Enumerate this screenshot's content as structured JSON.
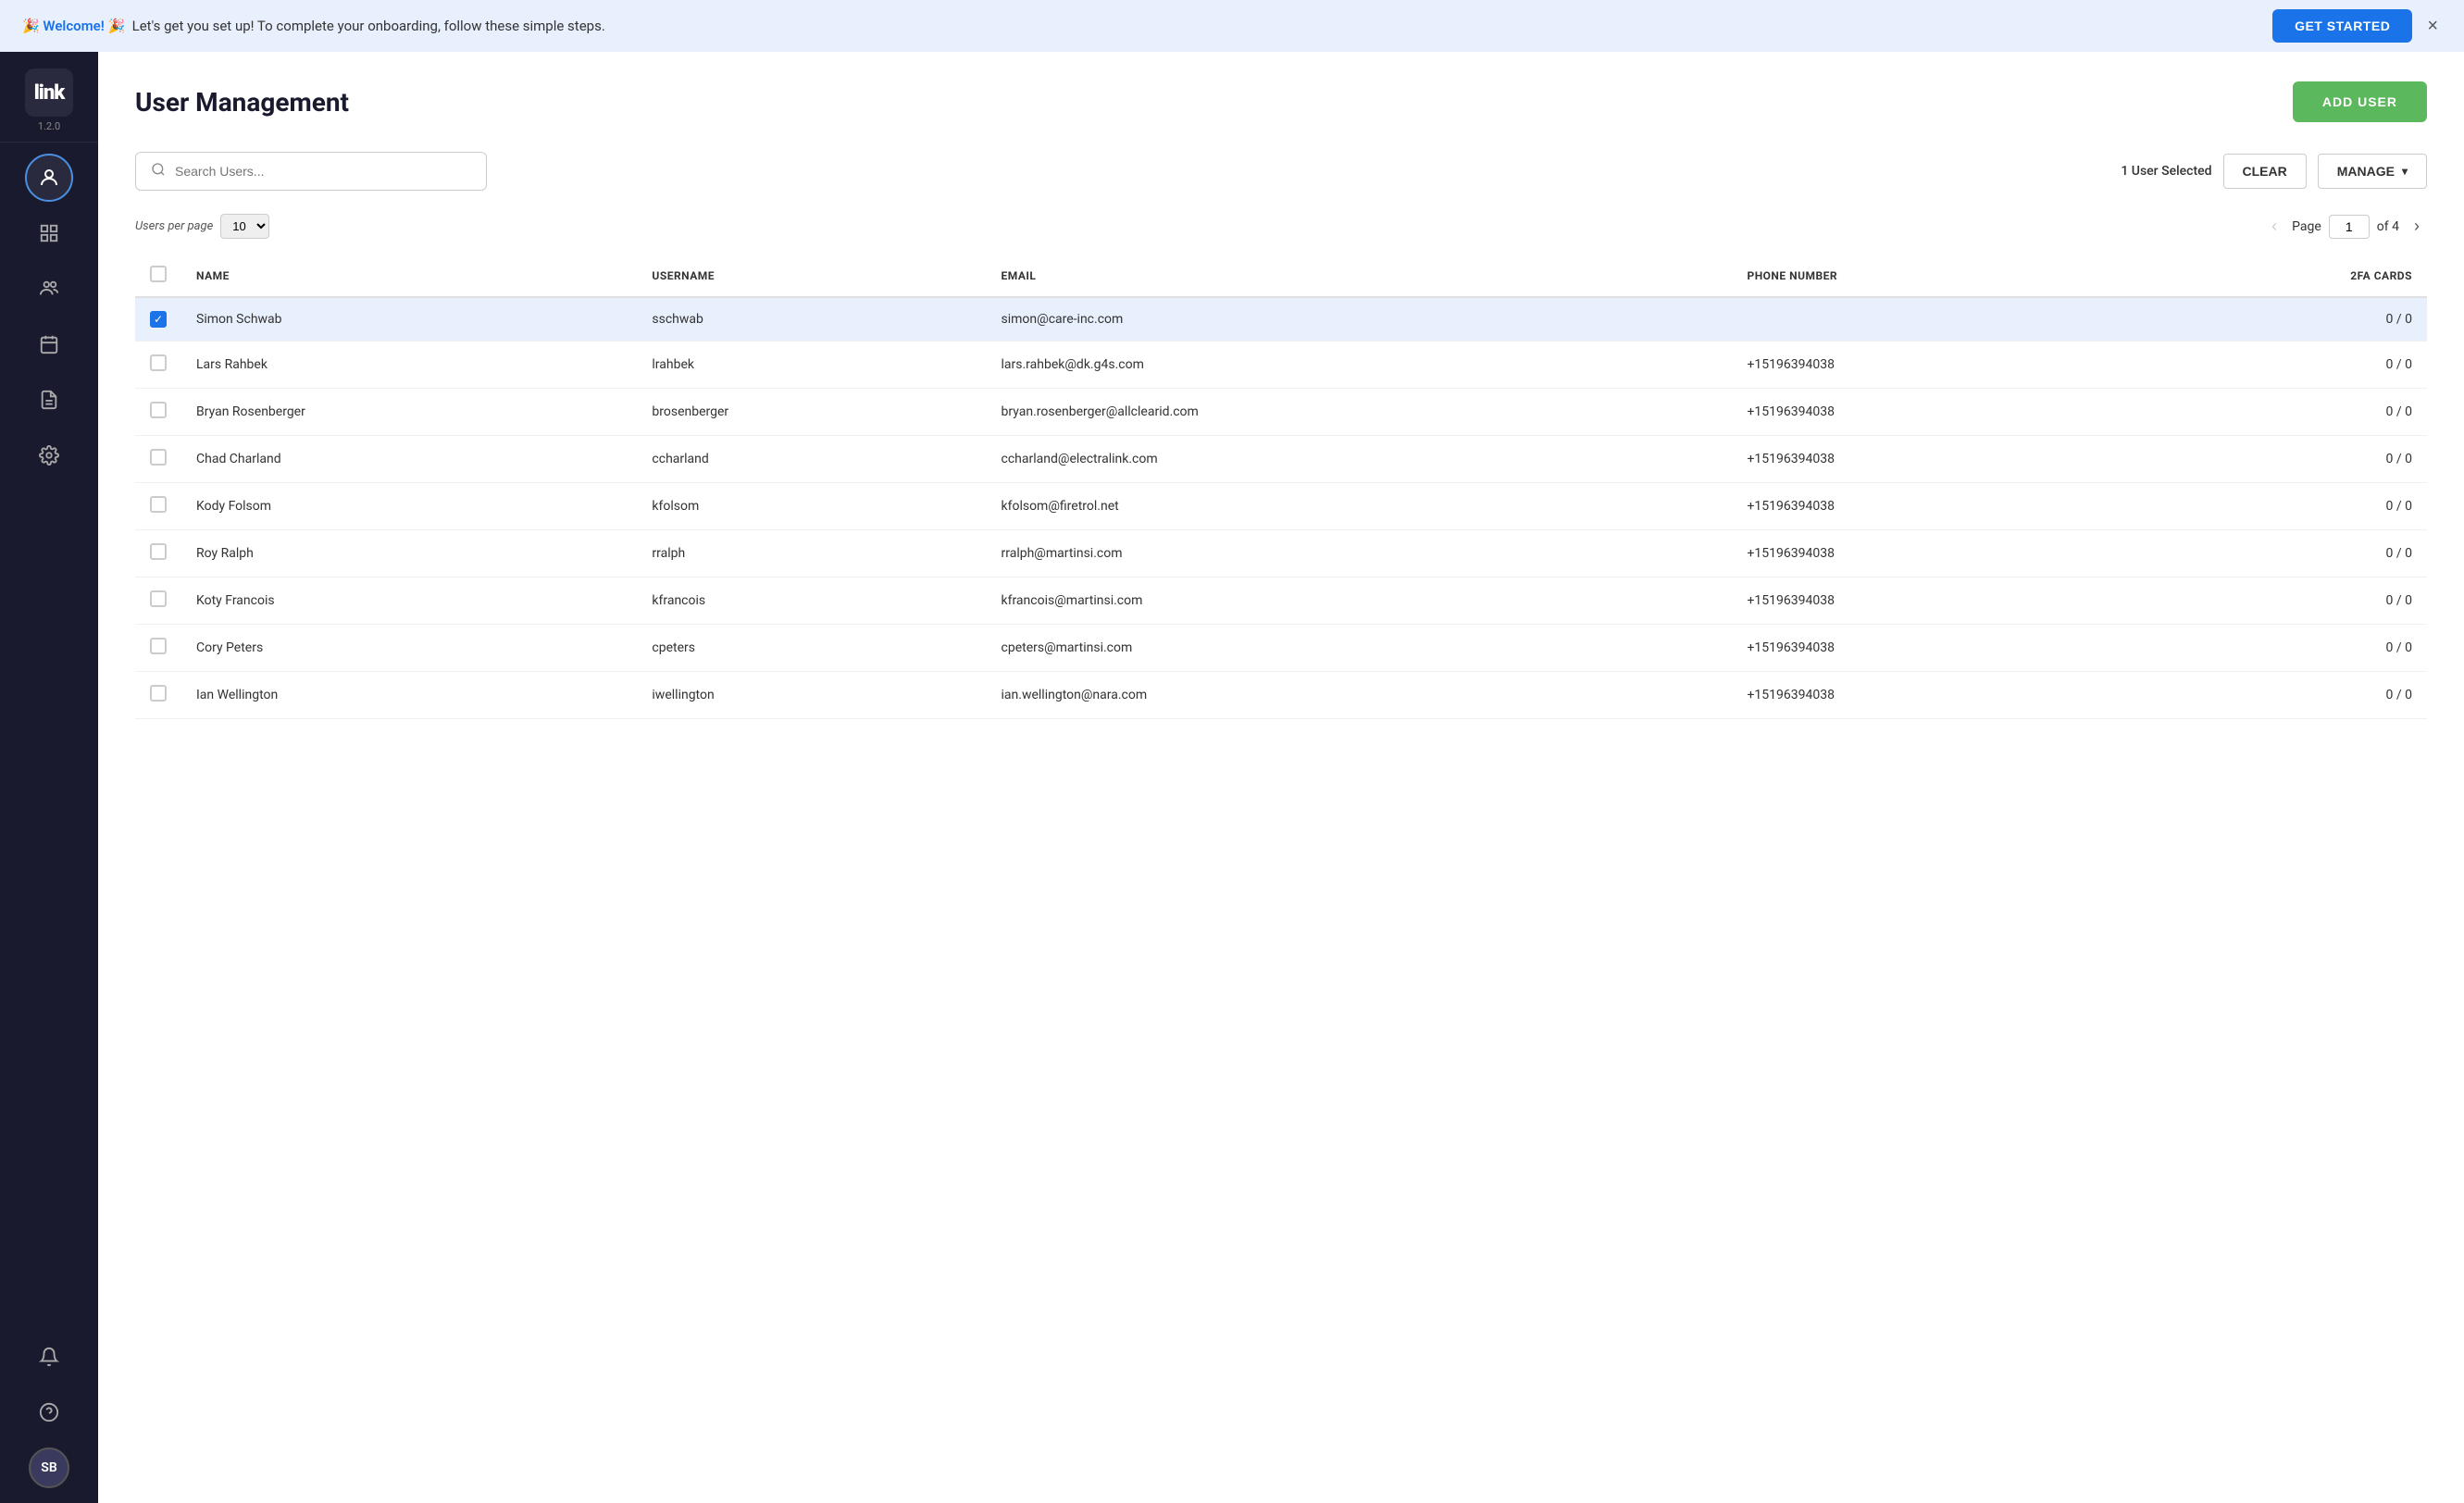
{
  "banner": {
    "emoji_left": "🎉",
    "welcome_text": "Welcome!",
    "emoji_right": "🎉",
    "message": "Let's get you set up! To complete your onboarding, follow these simple steps.",
    "get_started_label": "GET STARTED",
    "close_icon": "×"
  },
  "sidebar": {
    "logo_text": "link",
    "version": "1.2.0",
    "icons": [
      {
        "name": "user-icon",
        "symbol": "◎",
        "active": true
      },
      {
        "name": "dashboard-icon",
        "symbol": "⊟",
        "active": false
      },
      {
        "name": "people-icon",
        "symbol": "👤",
        "active": false
      },
      {
        "name": "calendar-icon",
        "symbol": "◫",
        "active": false
      },
      {
        "name": "document-icon",
        "symbol": "📄",
        "active": false
      },
      {
        "name": "settings-icon",
        "symbol": "⚙",
        "active": false
      }
    ],
    "bottom_icons": [
      {
        "name": "bell-icon",
        "symbol": "🔔"
      },
      {
        "name": "help-icon",
        "symbol": "?"
      }
    ],
    "avatar_initials": "SB"
  },
  "page": {
    "title": "User Management",
    "add_user_label": "ADD USER"
  },
  "toolbar": {
    "search_placeholder": "Search Users...",
    "selected_count_text": "1 User Selected",
    "clear_label": "CLEAR",
    "manage_label": "MANAGE"
  },
  "pagination": {
    "per_page_label": "Users per page",
    "per_page_value": "10",
    "page_label": "Page",
    "current_page": "1",
    "total_pages": "4",
    "of_label": "of"
  },
  "table": {
    "headers": [
      "",
      "NAME",
      "USERNAME",
      "EMAIL",
      "PHONE NUMBER",
      "2FA CARDS"
    ],
    "rows": [
      {
        "selected": true,
        "name": "Simon Schwab",
        "username": "sschwab",
        "email": "simon@care-inc.com",
        "phone": "",
        "tfa": "0 / 0"
      },
      {
        "selected": false,
        "name": "Lars Rahbek",
        "username": "lrahbek",
        "email": "lars.rahbek@dk.g4s.com",
        "phone": "+15196394038",
        "tfa": "0 / 0"
      },
      {
        "selected": false,
        "name": "Bryan Rosenberger",
        "username": "brosenberger",
        "email": "bryan.rosenberger@allclearid.com",
        "phone": "+15196394038",
        "tfa": "0 / 0"
      },
      {
        "selected": false,
        "name": "Chad Charland",
        "username": "ccharland",
        "email": "ccharland@electralink.com",
        "phone": "+15196394038",
        "tfa": "0 / 0"
      },
      {
        "selected": false,
        "name": "Kody Folsom",
        "username": "kfolsom",
        "email": "kfolsom@firetrol.net",
        "phone": "+15196394038",
        "tfa": "0 / 0"
      },
      {
        "selected": false,
        "name": "Roy Ralph",
        "username": "rralph",
        "email": "rralph@martinsi.com",
        "phone": "+15196394038",
        "tfa": "0 / 0"
      },
      {
        "selected": false,
        "name": "Koty Francois",
        "username": "kfrancois",
        "email": "kfrancois@martinsi.com",
        "phone": "+15196394038",
        "tfa": "0 / 0"
      },
      {
        "selected": false,
        "name": "Cory Peters",
        "username": "cpeters",
        "email": "cpeters@martinsi.com",
        "phone": "+15196394038",
        "tfa": "0 / 0"
      },
      {
        "selected": false,
        "name": "Ian Wellington",
        "username": "iwellington",
        "email": "ian.wellington@nara.com",
        "phone": "+15196394038",
        "tfa": "0 / 0"
      }
    ]
  }
}
